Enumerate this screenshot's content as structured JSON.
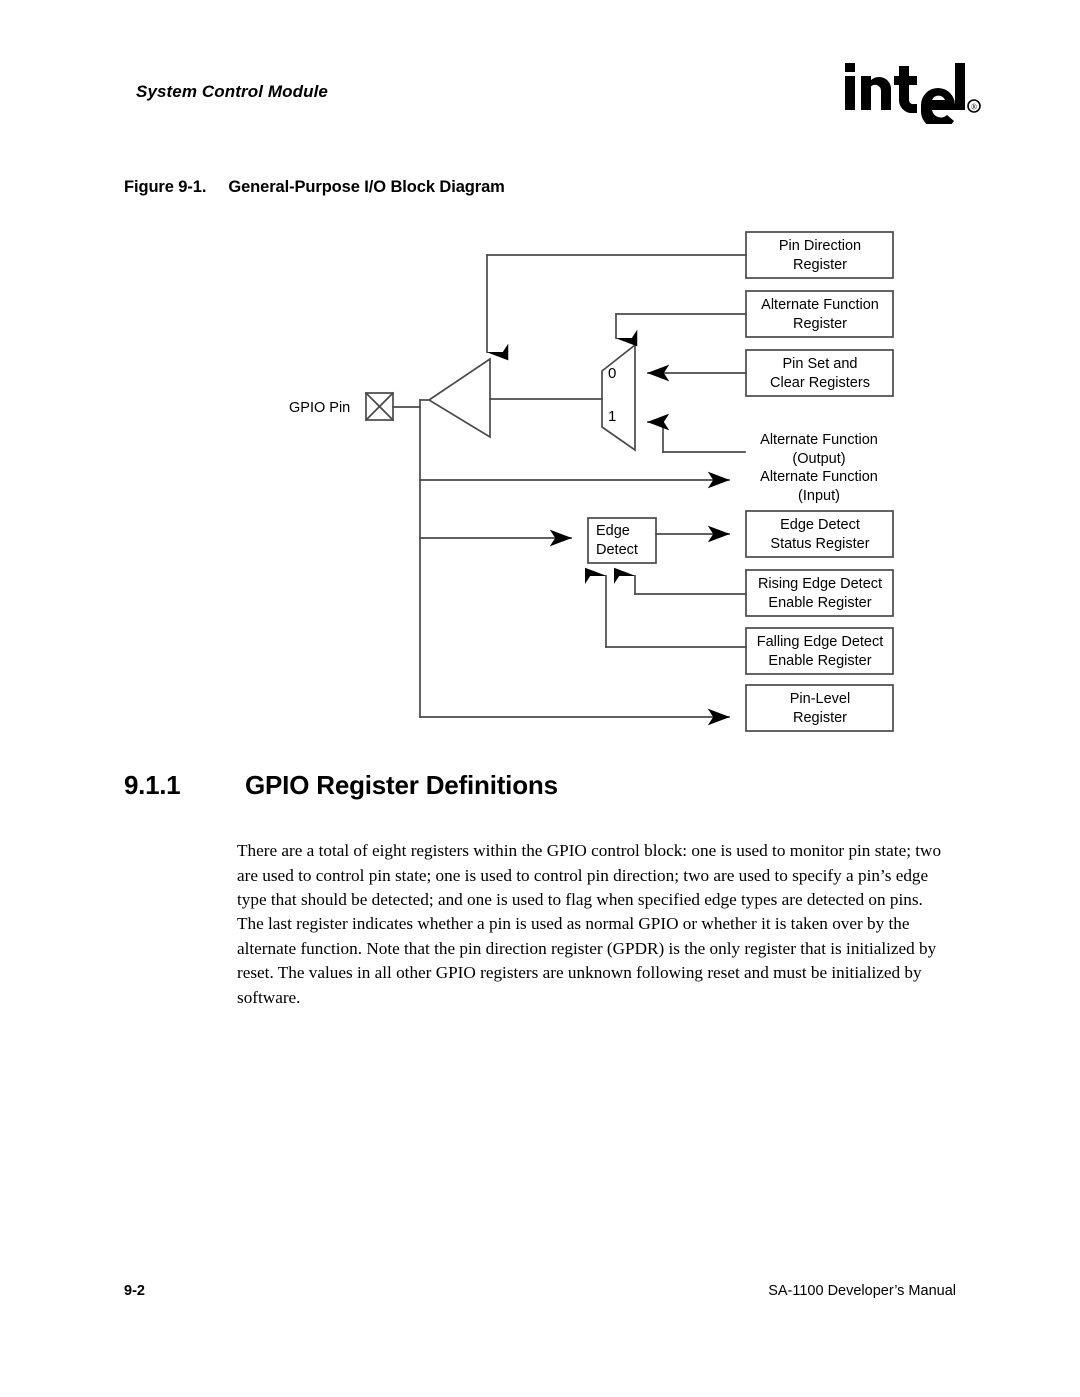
{
  "header": {
    "title": "System Control Module",
    "logo_text": "intel",
    "logo_trademark": "®"
  },
  "figure": {
    "number": "Figure 9-1.",
    "title": "General-Purpose I/O Block Diagram",
    "pin_label": "GPIO Pin",
    "mux_labels": {
      "input_0": "0",
      "input_1": "1"
    },
    "edge_detect_block": {
      "line1": "Edge",
      "line2": "Detect"
    },
    "registers": [
      {
        "id": "pin-direction-register",
        "line1": "Pin Direction",
        "line2": "Register"
      },
      {
        "id": "alternate-function-register",
        "line1": "Alternate Function",
        "line2": "Register"
      },
      {
        "id": "pin-set-and-clear-registers",
        "line1": "Pin Set and",
        "line2": "Clear Registers"
      },
      {
        "id": "edge-detect-status-register",
        "line1": "Edge Detect",
        "line2": "Status Register"
      },
      {
        "id": "rising-edge-detect-enable-register",
        "line1": "Rising Edge Detect",
        "line2": "Enable Register"
      },
      {
        "id": "falling-edge-detect-enable-register",
        "line1": "Falling Edge Detect",
        "line2": "Enable Register"
      },
      {
        "id": "pin-level-register",
        "line1": "Pin-Level",
        "line2": "Register"
      }
    ],
    "signal_labels": [
      {
        "id": "alternate-function-output",
        "line1": "Alternate Function",
        "line2": "(Output)"
      },
      {
        "id": "alternate-function-input",
        "line1": "Alternate Function",
        "line2": "(Input)"
      }
    ]
  },
  "section": {
    "number": "9.1.1",
    "title": "GPIO Register Definitions",
    "paragraph": "There are a total of eight registers within the GPIO control block: one is used to monitor pin state; two are used to control pin state; one is used to control pin direction; two are used to specify a pin’s edge type that should be detected; and one is used to flag when specified edge types are detected on pins. The last register indicates whether a pin is used as normal GPIO or whether it is taken over by the alternate function. Note that the pin direction register (GPDR) is the only register that is initialized by reset. The values in all other GPIO registers are unknown following reset and must be initialized by software."
  },
  "footer": {
    "page_number": "9-2",
    "manual_title": "SA-1100  Developer’s Manual"
  }
}
